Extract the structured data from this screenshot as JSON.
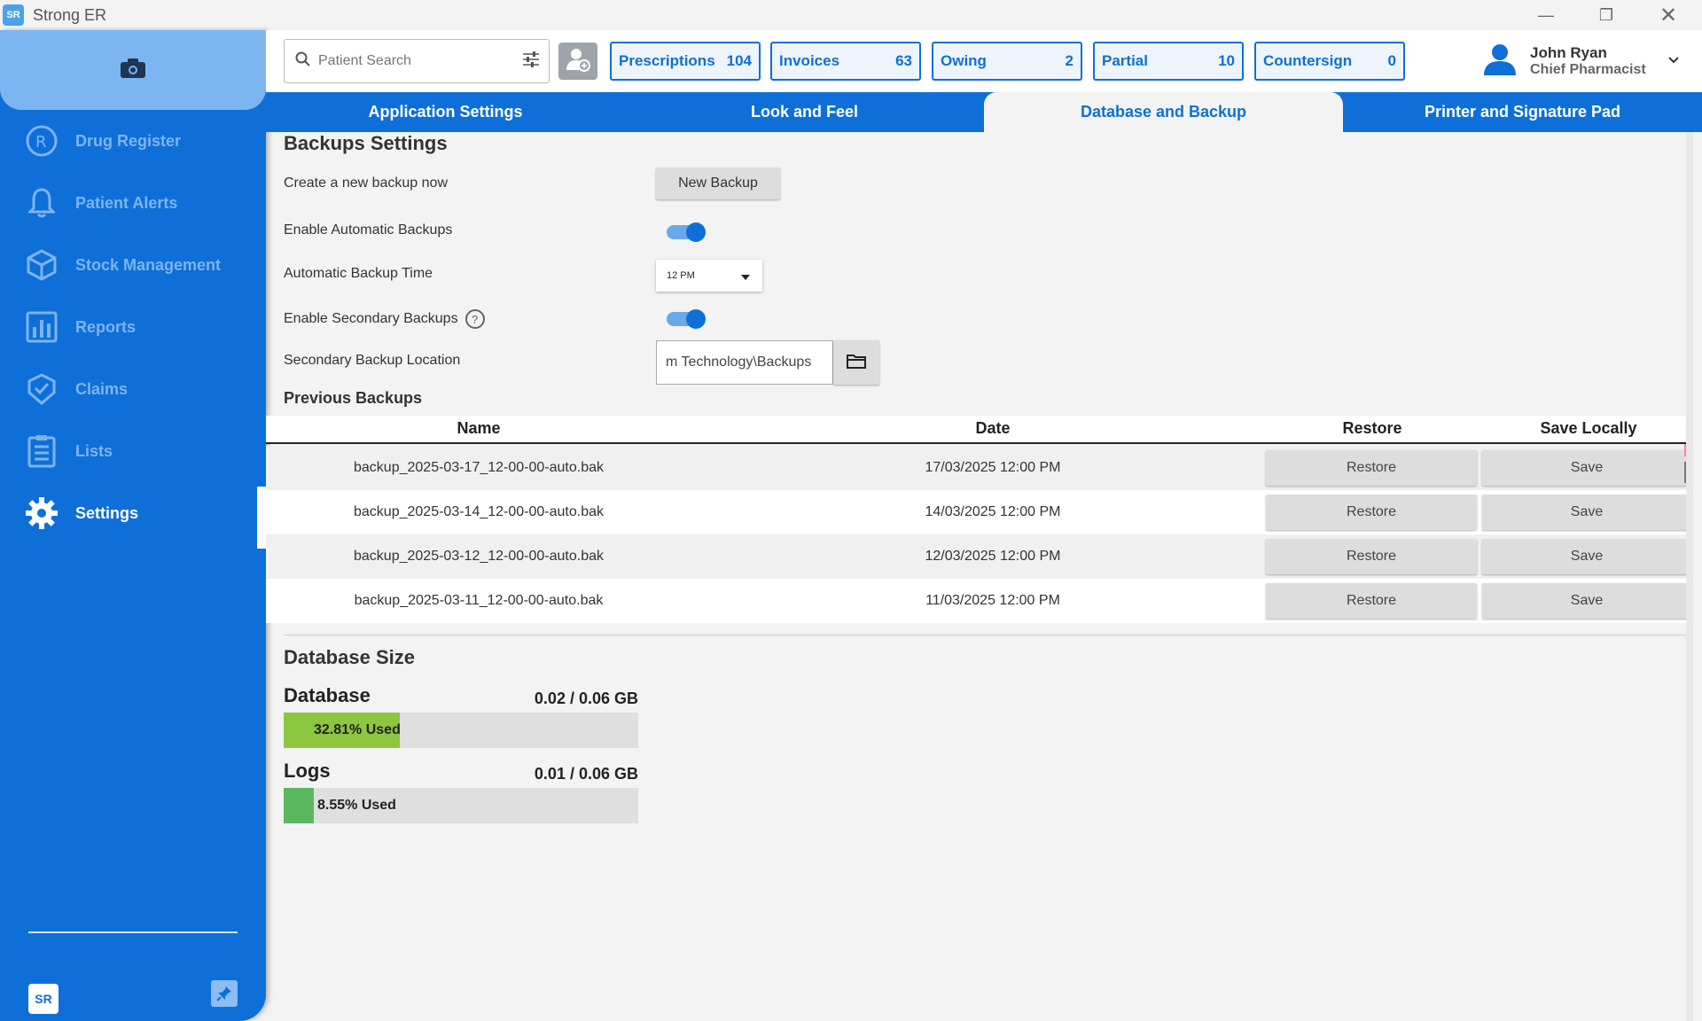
{
  "window": {
    "title": "Strong ER",
    "logo_text": "SR"
  },
  "sidebar": {
    "items": [
      {
        "label": "Drug Register",
        "icon": "rx-icon"
      },
      {
        "label": "Patient Alerts",
        "icon": "bell-icon"
      },
      {
        "label": "Stock Management",
        "icon": "box-icon"
      },
      {
        "label": "Reports",
        "icon": "bar-chart-icon"
      },
      {
        "label": "Claims",
        "icon": "shield-check-icon"
      },
      {
        "label": "Lists",
        "icon": "clipboard-list-icon"
      },
      {
        "label": "Settings",
        "icon": "gear-icon"
      }
    ],
    "active": "Settings",
    "bottom_logo": "SR"
  },
  "topbar": {
    "search_placeholder": "Patient Search",
    "counters": [
      {
        "label": "Prescriptions",
        "count": "104"
      },
      {
        "label": "Invoices",
        "count": "63"
      },
      {
        "label": "Owing",
        "count": "2"
      },
      {
        "label": "Partial",
        "count": "10"
      },
      {
        "label": "Countersign",
        "count": "0"
      }
    ],
    "user": {
      "name": "John Ryan",
      "role": "Chief Pharmacist"
    }
  },
  "tabs": [
    "Application Settings",
    "Look and Feel",
    "Database and Backup",
    "Printer and Signature Pad"
  ],
  "active_tab": "Database and Backup",
  "backup": {
    "title": "Backups Settings",
    "create_label": "Create a new backup now",
    "new_backup_button": "New Backup",
    "auto_label": "Enable Automatic Backups",
    "auto_enabled": true,
    "time_label": "Automatic Backup Time",
    "time_value": "12 PM",
    "secondary_label": "Enable Secondary Backups",
    "secondary_enabled": true,
    "help": "?",
    "location_label": "Secondary Backup Location",
    "location_value": "m Technology\\Backups"
  },
  "previous": {
    "title": "Previous Backups",
    "columns": [
      "Name",
      "Date",
      "Restore",
      "Save Locally"
    ],
    "rows": [
      {
        "name": "backup_2025-03-17_12-00-00-auto.bak",
        "date": "17/03/2025 12:00 PM",
        "restore": "Restore",
        "save": "Save"
      },
      {
        "name": "backup_2025-03-14_12-00-00-auto.bak",
        "date": "14/03/2025 12:00 PM",
        "restore": "Restore",
        "save": "Save"
      },
      {
        "name": "backup_2025-03-12_12-00-00-auto.bak",
        "date": "12/03/2025 12:00 PM",
        "restore": "Restore",
        "save": "Save"
      },
      {
        "name": "backup_2025-03-11_12-00-00-auto.bak",
        "date": "11/03/2025 12:00 PM",
        "restore": "Restore",
        "save": "Save"
      }
    ]
  },
  "db_size": {
    "title": "Database Size",
    "database": {
      "label": "Database",
      "value": "0.02 / 0.06 GB",
      "used_text": "32.81% Used",
      "fraction": 0.3281,
      "color": "#8dc63f"
    },
    "logs": {
      "label": "Logs",
      "value": "0.01 / 0.06 GB",
      "used_text": "8.55% Used",
      "fraction": 0.0855,
      "color": "#5cb85c"
    }
  },
  "colors": {
    "primary": "#0e6fd8",
    "sidebar_top": "#7cb5f2"
  }
}
